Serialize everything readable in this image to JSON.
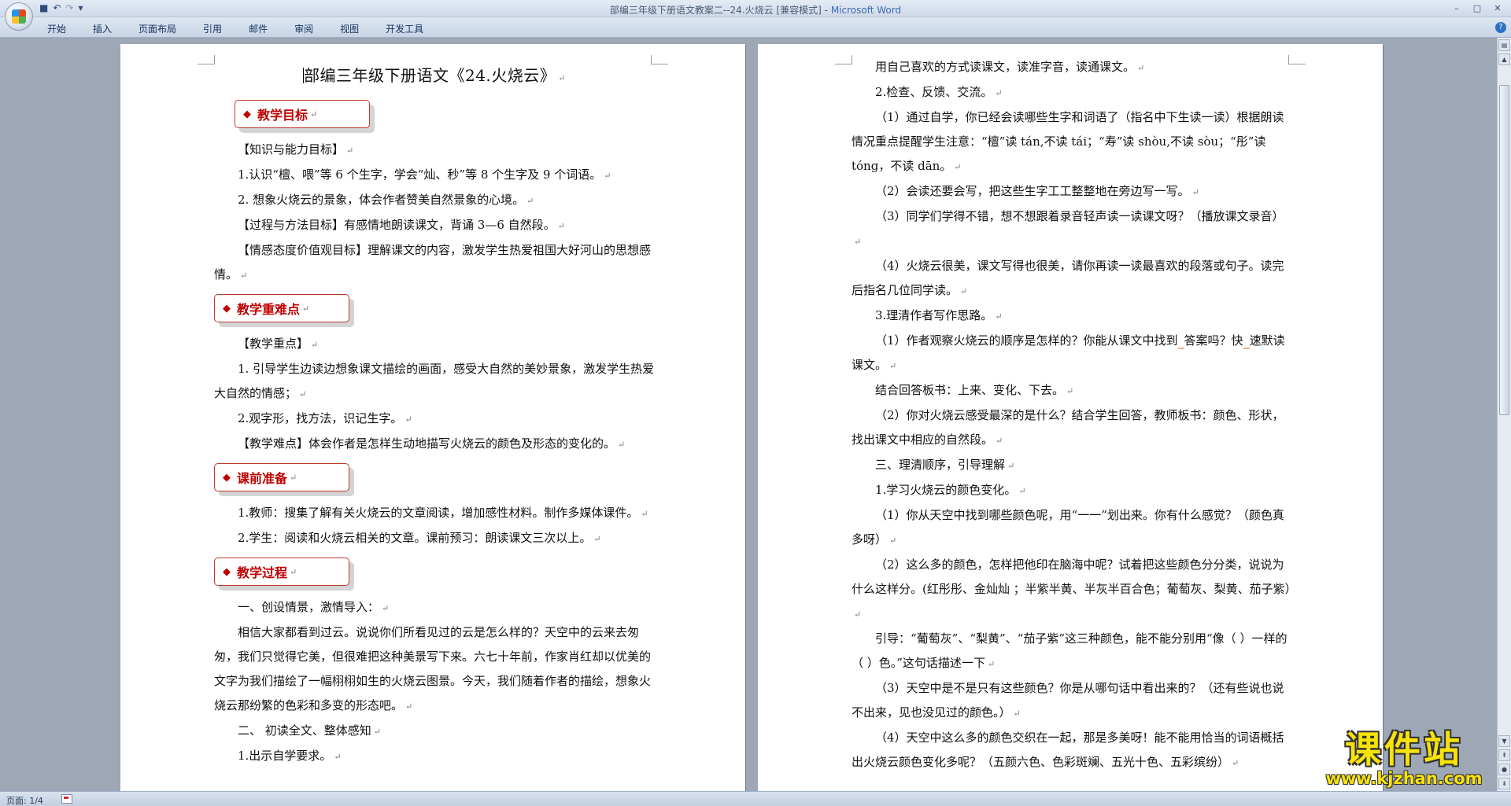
{
  "window": {
    "title": "部编三年级下册语文教案二--24.火烧云 [兼容模式]",
    "app_name": "Microsoft Word",
    "qat_save": "■",
    "qat_undo": "↶",
    "qat_redo": "↷",
    "qat_more": "▾"
  },
  "ribbon": {
    "tabs": [
      "开始",
      "插入",
      "页面布局",
      "引用",
      "邮件",
      "审阅",
      "视图",
      "开发工具"
    ]
  },
  "left_page": {
    "title": "部编三年级下册语文《24.火烧云》",
    "heading_goal": "教学目标",
    "goal_1": "【知识与能力目标】",
    "goal_2": "1.认识“檀、喂”等 6 个生字，学会“灿、秒”等 8 个生字及 9 个词语。",
    "goal_3": "2. 想象火烧云的景象，体会作者赞美自然景象的心境。",
    "goal_4": "【过程与方法目标】有感情地朗读课文，背诵 3—6 自然段。",
    "goal_5": "【情感态度价值观目标】理解课文的内容，激发学生热爱祖国大好河山的思想感情。",
    "heading_key": "教学重难点",
    "key_1": "【教学重点】",
    "key_2": "1. 引导学生边读边想象课文描绘的画面，感受大自然的美妙景象，激发学生热爱大自然的情感；",
    "key_3": "2.观字形，找方法，识记生字。",
    "key_4": "【教学难点】体会作者是怎样生动地描写火烧云的颜色及形态的变化的。",
    "heading_prep": "课前准备",
    "prep_1": "1.教师：搜集了解有关火烧云的文章阅读，增加感性材料。制作多媒体课件。",
    "prep_2": "2.学生：阅读和火烧云相关的文章。课前预习：朗读课文三次以上。",
    "heading_process": "教学过程",
    "proc_1": "一、创设情景，激情导入：",
    "proc_2": "相信大家都看到过云。说说你们所看见过的云是怎么样的？天空中的云来去匆匆，我们只觉得它美，但很难把这种美景写下来。六七十年前，作家肖红却以优美的文字为我们描绘了一幅栩栩如生的火烧云图景。今天，我们随着作者的描绘，想象火烧云那纷繁的色彩和多变的形态吧。",
    "proc_3": "二、 初读全文、整体感知",
    "proc_4": "1.出示自学要求。"
  },
  "right_page": {
    "r_1": "用自己喜欢的方式读课文，读准字音，读通课文。",
    "r_2": "2.检查、反馈、交流。",
    "r_3": "（1）通过自学，你已经会读哪些生字和词语了（指名中下生读一读）根据朗读情况重点提醒学生注意：“檀”读 tán,不读 tái；“寿”读 shòu,不读 sòu；“彤”读 tóng，不读 dān。",
    "r_4": "（2）会读还要会写，把这些生字工工整整地在旁边写一写。",
    "r_5": "（3）同学们学得不错，想不想跟着录音轻声读一读课文呀？（播放课文录音）",
    "r_6": "（4）火烧云很美，课文写得也很美，请你再读一读最喜欢的段落或句子。读完后指名几位同学读。",
    "r_7": "3.理清作者写作思路。",
    "r_8a": "（1）作者观察火烧云的顺序是怎样的？你能从课文中找到",
    "r_8b": "答案吗？快",
    "r_8c": "速默读课文。",
    "r_9": "结合回答板书：上来、变化、下去。",
    "r_10": "（2）你对火烧云感受最深的是什么？结合学生回答，教师板书：颜色、形状，找出课文中相应的自然段。",
    "r_11": "三、理清顺序，引导理解",
    "r_12": "1.学习火烧云的颜色变化。",
    "r_13": "（1）你从天空中找到哪些颜色呢，用“一一”划出来。你有什么感觉？（颜色真多呀）",
    "r_14": "（2）这么多的颜色，怎样把他印在脑海中呢？试着把这些颜色分分类，说说为什么这样分。(红彤彤、金灿灿 ；半紫半黄、半灰半百合色；葡萄灰、梨黄、茄子紫）",
    "r_15": "引导：“葡萄灰”、“梨黄”、“茄子紫”这三种颜色，能不能分别用“像（ ）一样的（ ）色。”这句话描述一下",
    "r_16": "（3）天空中是不是只有这些颜色？你是从哪句话中看出来的？（还有些说也说不出来，见也没见过的颜色。）",
    "r_17": "（4）天空中这么多的颜色交织在一起，那是多美呀！能不能用恰当的词语概括出火烧云颜色变化多呢？（五颜六色、色彩斑斓、五光十色、五彩缤纷）"
  },
  "status": {
    "page_info": "页面: 1/4"
  },
  "watermark": {
    "title": "课件站",
    "url": "www.kjzhan.com"
  }
}
